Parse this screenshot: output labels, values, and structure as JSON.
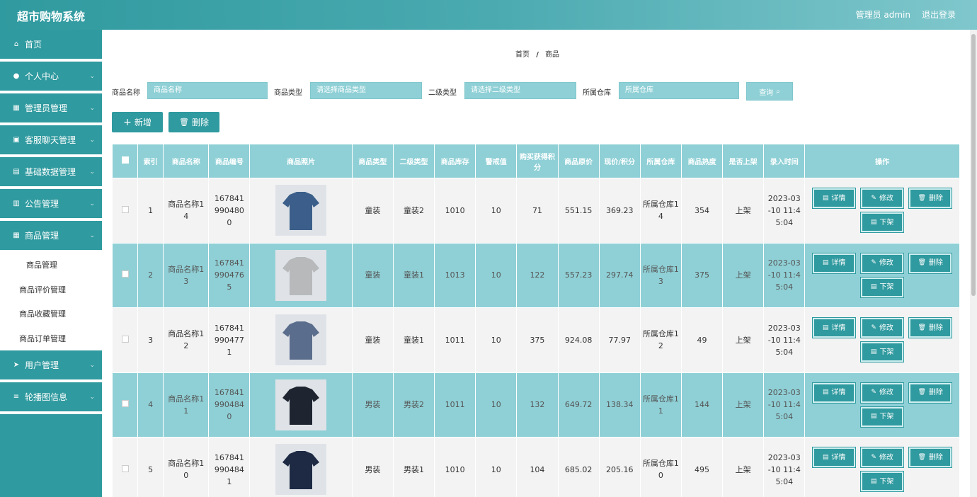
{
  "header": {
    "title": "超市购物系统",
    "admin": "管理员 admin",
    "logout": "退出登录"
  },
  "sidebar": {
    "items": [
      {
        "label": "首页",
        "icon": "home-icon",
        "glyph": "⌂",
        "expandable": false
      },
      {
        "label": "个人中心",
        "icon": "user-icon",
        "glyph": "●",
        "expandable": true
      },
      {
        "label": "管理员管理",
        "icon": "grid-icon",
        "glyph": "▦",
        "expandable": true
      },
      {
        "label": "客服聊天管理",
        "icon": "briefcase-icon",
        "glyph": "▣",
        "expandable": true
      },
      {
        "label": "基础数据管理",
        "icon": "data-icon",
        "glyph": "▤",
        "expandable": true
      },
      {
        "label": "公告管理",
        "icon": "chart-icon",
        "glyph": "▥",
        "expandable": true
      },
      {
        "label": "商品管理",
        "icon": "grid-icon",
        "glyph": "▦",
        "expandable": true
      }
    ],
    "submenu": [
      "商品管理",
      "商品评价管理",
      "商品收藏管理",
      "商品订单管理"
    ],
    "items_after": [
      {
        "label": "用户管理",
        "icon": "send-icon",
        "glyph": "➤",
        "expandable": true
      },
      {
        "label": "轮播图信息",
        "icon": "sliders-icon",
        "glyph": "≡",
        "expandable": true
      }
    ]
  },
  "breadcrumb": {
    "home": "首页",
    "sep": "/",
    "current": "商品"
  },
  "search": {
    "name_label": "商品名称",
    "name_placeholder": "商品名称",
    "type_label": "商品类型",
    "type_placeholder": "请选择商品类型",
    "subtype_label": "二级类型",
    "subtype_placeholder": "请选择二级类型",
    "warehouse_label": "所属仓库",
    "warehouse_placeholder": "所属仓库",
    "query_label": "查询"
  },
  "actions": {
    "add": "新增",
    "delete": "删除"
  },
  "table": {
    "headers": [
      "索引",
      "商品名称",
      "商品编号",
      "商品照片",
      "商品类型",
      "二级类型",
      "商品库存",
      "警戒值",
      "购买获得积分",
      "商品原价",
      "现价/积分",
      "所属仓库",
      "商品热度",
      "是否上架",
      "录入时间",
      "操作"
    ],
    "rows": [
      {
        "index": "1",
        "name": "商品名称14",
        "code": "1678419904800",
        "type": "童装",
        "subtype": "童装2",
        "stock": "1010",
        "warn": "10",
        "points": "71",
        "orig": "551.15",
        "price": "369.23",
        "warehouse": "所属仓库14",
        "heat": "354",
        "status": "上架",
        "time": "2023-03-10 11:45:04",
        "img_color": "#3b5f8a"
      },
      {
        "index": "2",
        "name": "商品名称13",
        "code": "1678419904765",
        "type": "童装",
        "subtype": "童装1",
        "stock": "1013",
        "warn": "10",
        "points": "122",
        "orig": "557.23",
        "price": "297.74",
        "warehouse": "所属仓库13",
        "heat": "375",
        "status": "上架",
        "time": "2023-03-10 11:45:04",
        "img_color": "#b7b9bb"
      },
      {
        "index": "3",
        "name": "商品名称12",
        "code": "1678419904771",
        "type": "童装",
        "subtype": "童装1",
        "stock": "1011",
        "warn": "10",
        "points": "375",
        "orig": "924.08",
        "price": "77.97",
        "warehouse": "所属仓库12",
        "heat": "49",
        "status": "上架",
        "time": "2023-03-10 11:45:04",
        "img_color": "#5b6d8c"
      },
      {
        "index": "4",
        "name": "商品名称11",
        "code": "1678419904840",
        "type": "男装",
        "subtype": "男装2",
        "stock": "1011",
        "warn": "10",
        "points": "132",
        "orig": "649.72",
        "price": "138.34",
        "warehouse": "所属仓库11",
        "heat": "144",
        "status": "上架",
        "time": "2023-03-10 11:45:04",
        "img_color": "#1f2530"
      },
      {
        "index": "5",
        "name": "商品名称10",
        "code": "1678419904841",
        "type": "男装",
        "subtype": "男装1",
        "stock": "1010",
        "warn": "10",
        "points": "104",
        "orig": "685.02",
        "price": "205.16",
        "warehouse": "所属仓库10",
        "heat": "495",
        "status": "上架",
        "time": "2023-03-10 11:45:04",
        "img_color": "#1e2a44"
      }
    ],
    "op_labels": {
      "detail": "详情",
      "edit": "修改",
      "delete": "删除",
      "offshelf": "下架"
    }
  },
  "colors": {
    "primary": "#2f9a9f",
    "header_cell": "#8fd0d6",
    "row_odd": "#f3f3f3"
  }
}
